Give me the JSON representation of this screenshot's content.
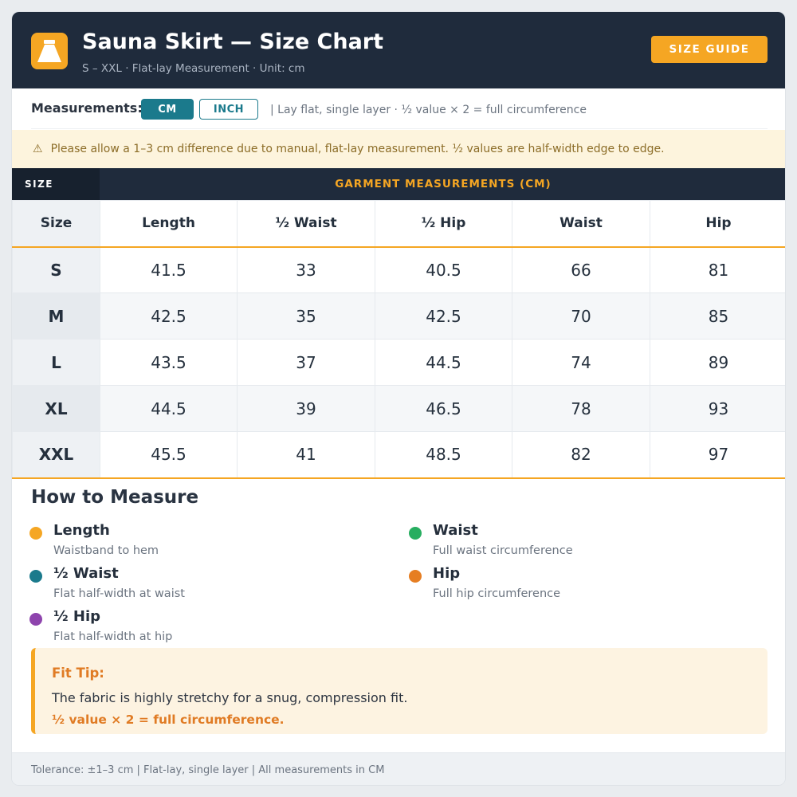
{
  "header": {
    "title": "Sauna Skirt — Size Chart",
    "subtitle": "S – XXL · Flat-lay Measurement · Unit: cm",
    "logo_icon": "skirt-icon",
    "size_guide_label": "SIZE GUIDE"
  },
  "units": {
    "label": "Measurements:",
    "options": [
      "CM",
      "INCH"
    ],
    "selected": "CM",
    "note": "| Lay flat, single layer · ½ value × 2 = full circumference"
  },
  "warning": {
    "icon": "warning-icon",
    "text": "Please allow a 1–3 cm difference due to manual, flat-lay measurement. ½ values are half-width edge to edge."
  },
  "table": {
    "band_size_label": "SIZE",
    "band_group_label": "GARMENT MEASUREMENTS (CM)",
    "columns": [
      "Size",
      "Length",
      "½ Waist",
      "½ Hip",
      "Waist",
      "Hip"
    ],
    "rows": [
      [
        "S",
        "41.5",
        "33",
        "40.5",
        "66",
        "81"
      ],
      [
        "M",
        "42.5",
        "35",
        "42.5",
        "70",
        "85"
      ],
      [
        "L",
        "43.5",
        "37",
        "44.5",
        "74",
        "89"
      ],
      [
        "XL",
        "44.5",
        "39",
        "46.5",
        "78",
        "93"
      ],
      [
        "XXL",
        "45.5",
        "41",
        "48.5",
        "82",
        "97"
      ]
    ]
  },
  "how_to_measure": {
    "title": "How to Measure",
    "items": [
      {
        "name": "Length",
        "desc": "Waistband to hem",
        "color": "#f5a623"
      },
      {
        "name": "½ Waist",
        "desc": "Flat half-width at waist",
        "color": "#1b7a8c"
      },
      {
        "name": "½ Hip",
        "desc": "Flat half-width at hip",
        "color": "#8e44ad"
      },
      {
        "name": "Waist",
        "desc": "Full waist circumference",
        "color": "#27ae60"
      },
      {
        "name": "Hip",
        "desc": "Full hip circumference",
        "color": "#e67e22"
      }
    ]
  },
  "fit_tip": {
    "title": "Fit Tip:",
    "body": "The fabric is highly stretchy for a snug, compression fit.",
    "formula": "½ value × 2 = full circumference."
  },
  "footer": {
    "text": "Tolerance: ±1–3 cm | Flat-lay, single layer | All measurements in CM"
  },
  "colors": {
    "header_bg": "#1f2b3c",
    "accent": "#f5a623",
    "teal": "#1b7a8c"
  }
}
